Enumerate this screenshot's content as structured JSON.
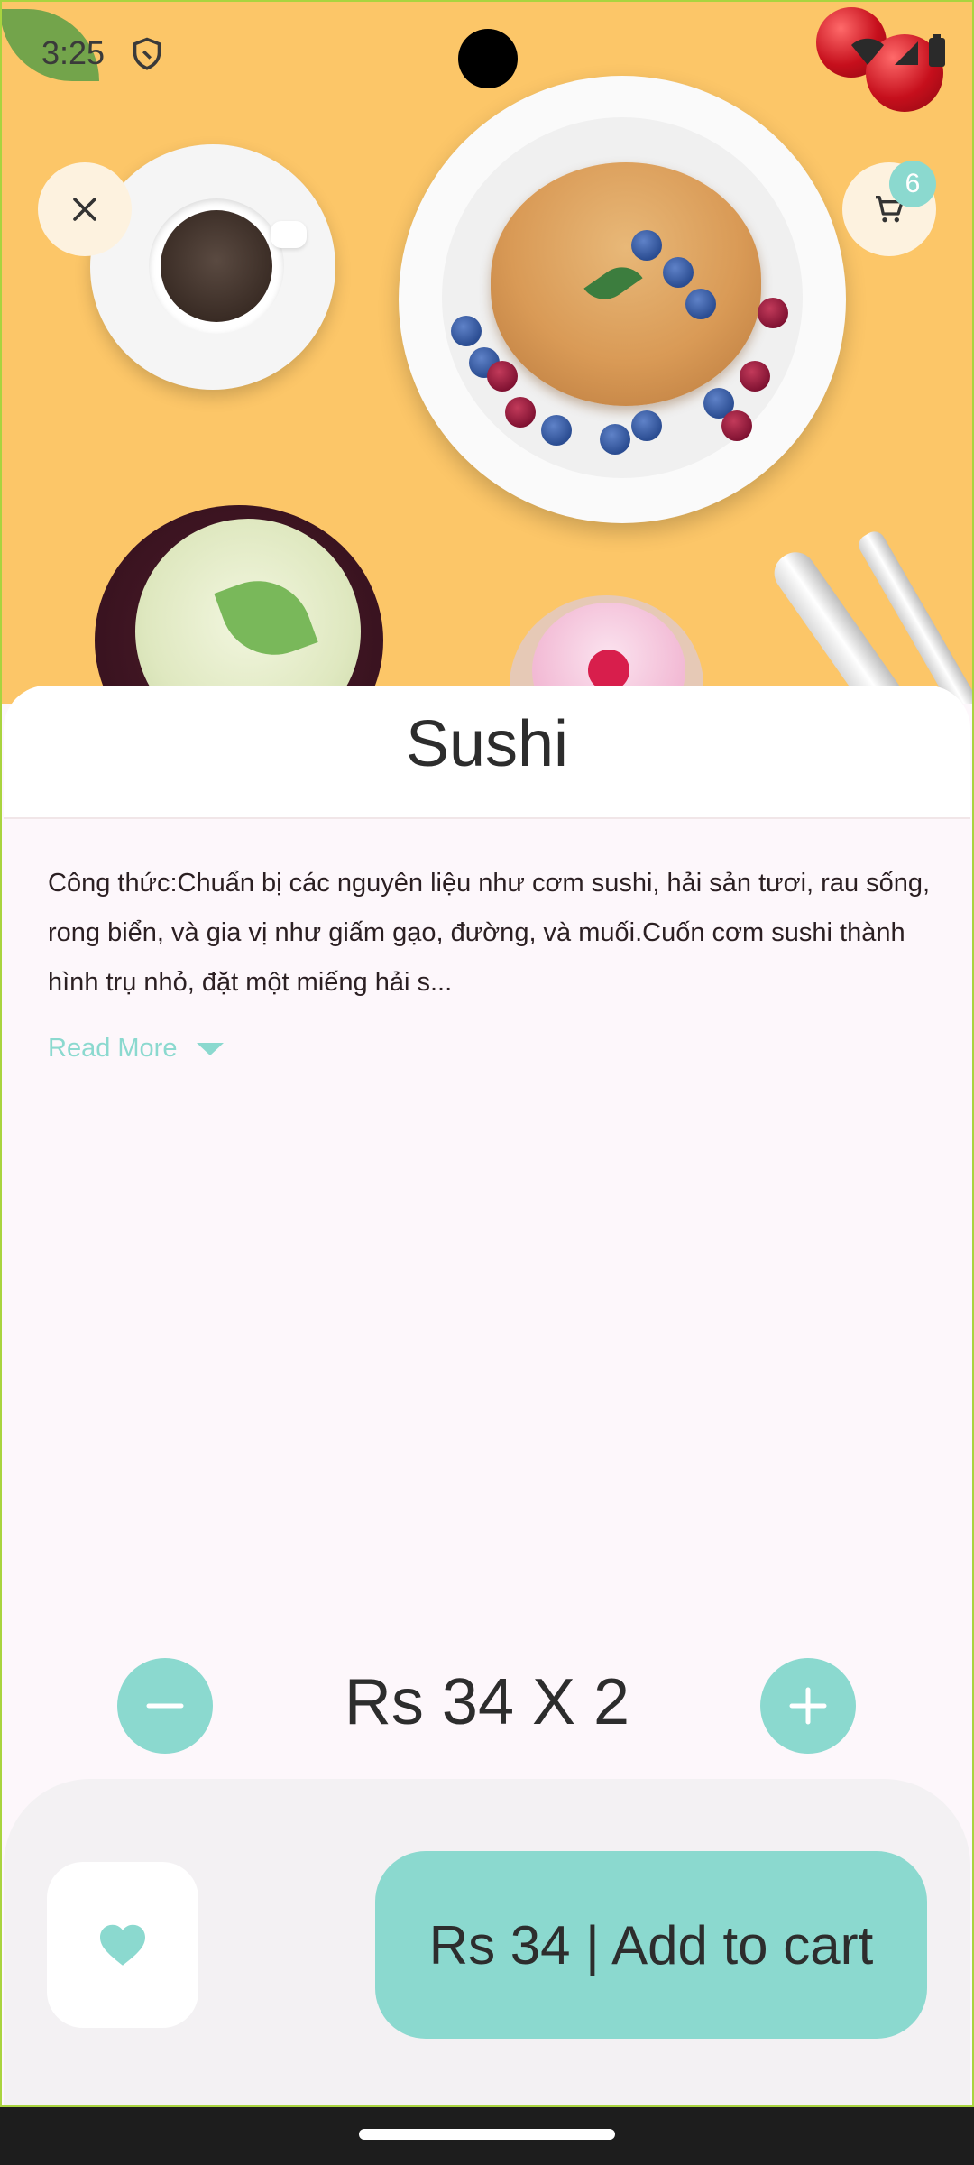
{
  "status_bar": {
    "time": "3:25"
  },
  "header": {
    "cart_count": "6"
  },
  "product": {
    "title": "Sushi",
    "description": "Công thức:Chuẩn bị các nguyên liệu như cơm sushi, hải sản tươi, rau sống, rong biển, và gia vị như giấm gạo, đường, và muối.Cuốn cơm sushi thành hình trụ nhỏ, đặt một miếng hải s...",
    "read_more_label": "Read More",
    "quantity_text": "Rs 34 X 2",
    "add_to_cart_label": "Rs 34 | Add to cart"
  },
  "colors": {
    "accent": "#8bd9cf",
    "hero_bg": "#fcc668"
  }
}
